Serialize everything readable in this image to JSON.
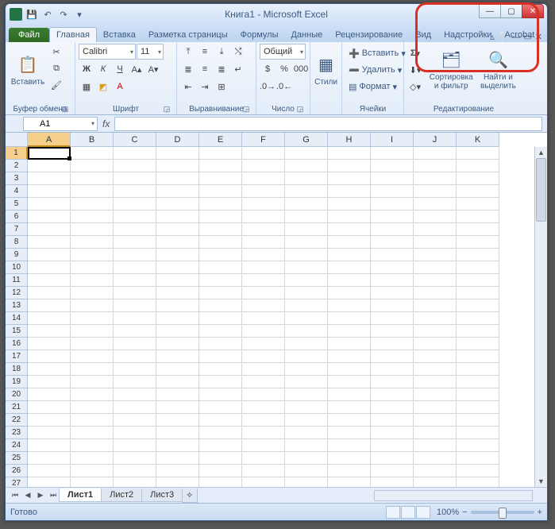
{
  "title": "Книга1 - Microsoft Excel",
  "tabs": {
    "file": "Файл",
    "home": "Главная",
    "insert": "Вставка",
    "layout": "Разметка страницы",
    "formulas": "Формулы",
    "data": "Данные",
    "review": "Рецензирование",
    "view": "Вид",
    "addins": "Надстройки",
    "acrobat": "Acrobat"
  },
  "ribbon": {
    "clipboard": {
      "paste": "Вставить",
      "label": "Буфер обмена"
    },
    "font": {
      "name": "Calibri",
      "size": "11",
      "label": "Шрифт"
    },
    "align": {
      "label": "Выравнивание"
    },
    "number": {
      "format": "Общий",
      "label": "Число"
    },
    "styles": {
      "label": "Стили"
    },
    "cells": {
      "insert": "Вставить",
      "delete": "Удалить",
      "format": "Формат",
      "label": "Ячейки"
    },
    "editing": {
      "sort": "Сортировка и фильтр",
      "find": "Найти и выделить",
      "label": "Редактирование"
    }
  },
  "namebox": "A1",
  "columns": [
    "A",
    "B",
    "C",
    "D",
    "E",
    "F",
    "G",
    "H",
    "I",
    "J",
    "K"
  ],
  "rows": [
    "1",
    "2",
    "3",
    "4",
    "5",
    "6",
    "7",
    "8",
    "9",
    "10",
    "11",
    "12",
    "13",
    "14",
    "15",
    "16",
    "17",
    "18",
    "19",
    "20",
    "21",
    "22",
    "23",
    "24",
    "25",
    "26",
    "27"
  ],
  "sheets": {
    "s1": "Лист1",
    "s2": "Лист2",
    "s3": "Лист3"
  },
  "status": {
    "ready": "Готово",
    "zoom": "100%"
  }
}
